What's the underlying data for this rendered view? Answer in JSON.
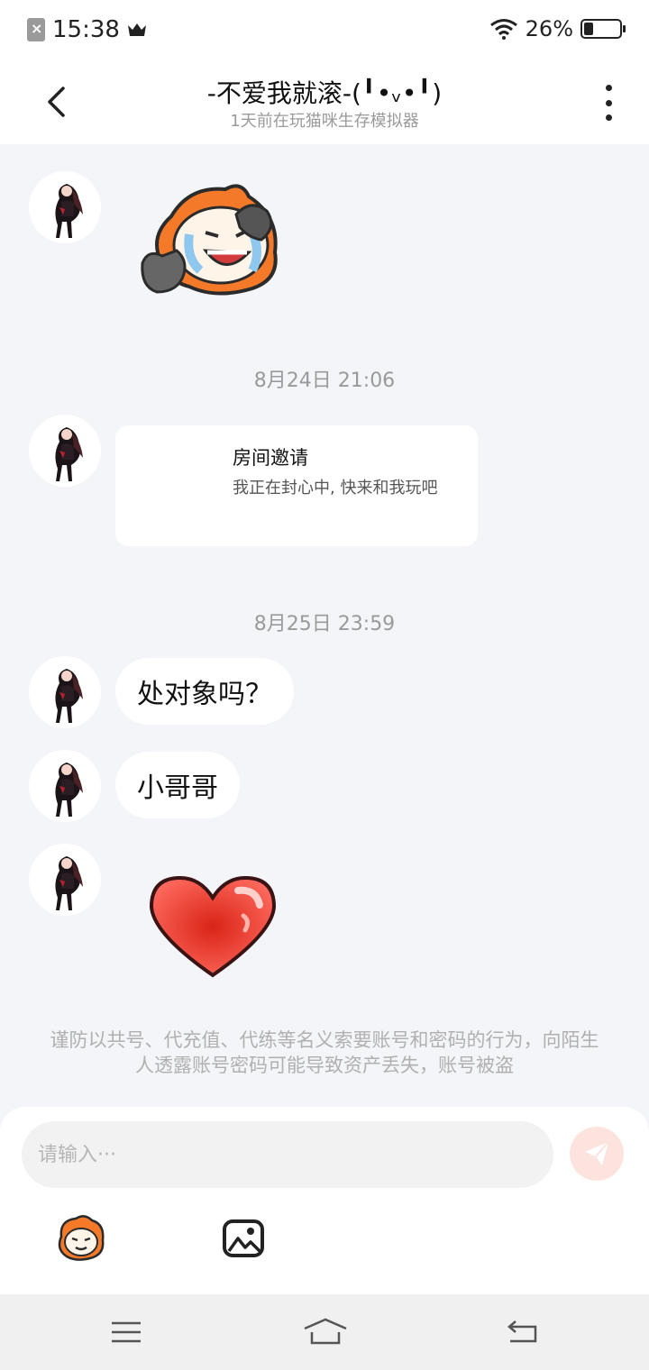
{
  "status_bar": {
    "time": "15:38",
    "battery_percent": "26%",
    "battery_level": 0.26,
    "icons": [
      "sim-icon",
      "crown-icon",
      "wifi-icon",
      "battery-icon"
    ]
  },
  "header": {
    "title": "-不爱我就滚-(╹•ᵥ•╹)",
    "subtitle": "1天前在玩猫咪生存模拟器"
  },
  "messages": [
    {
      "type": "sticker",
      "sticker": "laughing-face-sticker"
    },
    {
      "type": "timestamp",
      "text": "8月24日 21:06"
    },
    {
      "type": "invite",
      "title": "房间邀请",
      "desc": "我正在封心中, 快来和我玩吧"
    },
    {
      "type": "timestamp",
      "text": "8月25日 23:59"
    },
    {
      "type": "text",
      "text": "处对象吗？"
    },
    {
      "type": "text",
      "text": "小哥哥"
    },
    {
      "type": "sticker",
      "sticker": "heart-sticker"
    }
  ],
  "warning": "谨防以共号、代充值、代练等名义索要账号和密码的行为，向陌生人透露账号密码可能导致资产丢失，账号被盗",
  "input": {
    "placeholder": "请输入···",
    "value": ""
  },
  "colors": {
    "background": "#f4f5f8",
    "send_button": "#fde3de",
    "heart": "#e0342b",
    "sticker_orange": "#f47a2a"
  }
}
